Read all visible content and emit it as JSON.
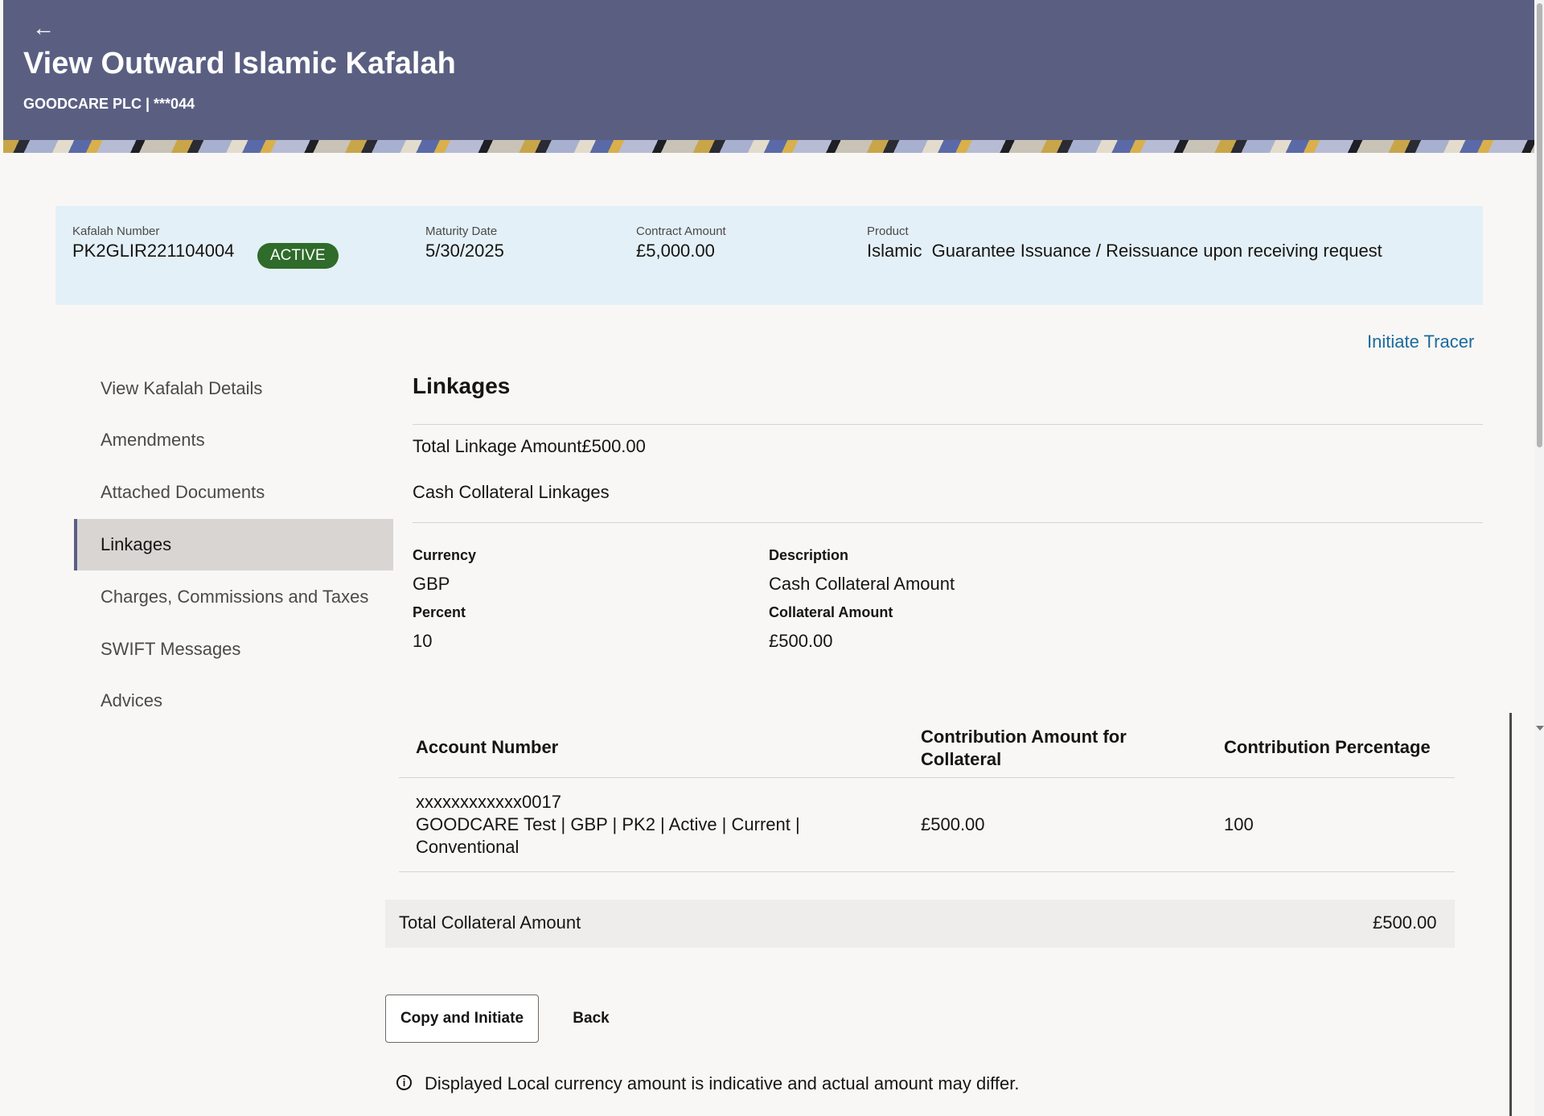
{
  "header": {
    "title": "View Outward Islamic Kafalah",
    "subtitle": "GOODCARE PLC | ***044"
  },
  "summary": {
    "kafalah_number_label": "Kafalah Number",
    "kafalah_number": "PK2GLIR221104004",
    "status": "ACTIVE",
    "status_color": "#2f6b2a",
    "maturity_date_label": "Maturity Date",
    "maturity_date": "5/30/2025",
    "contract_amount_label": "Contract Amount",
    "contract_amount": "£5,000.00",
    "product_label": "Product",
    "product": "Islamic  Guarantee Issuance / Reissuance upon receiving request"
  },
  "actions": {
    "initiate_tracer": "Initiate Tracer"
  },
  "nav": {
    "items": [
      {
        "label": "View Kafalah Details"
      },
      {
        "label": "Amendments"
      },
      {
        "label": "Attached Documents"
      },
      {
        "label": "Linkages"
      },
      {
        "label": "Charges, Commissions and Taxes"
      },
      {
        "label": "SWIFT Messages"
      },
      {
        "label": "Advices"
      }
    ],
    "active": "Linkages"
  },
  "linkages": {
    "title": "Linkages",
    "total_linkage": "Total Linkage Amount£500.00",
    "cash_collateral_heading": "Cash Collateral Linkages",
    "currency_label": "Currency",
    "currency": "GBP",
    "description_label": "Description",
    "description": "Cash Collateral Amount",
    "percent_label": "Percent",
    "percent": "10",
    "collateral_amount_label": "Collateral Amount",
    "collateral_amount": "£500.00"
  },
  "table": {
    "headers": {
      "account_number": "Account Number",
      "contribution_amount_line1": "Contribution Amount for",
      "contribution_amount_line2": "Collateral",
      "contribution_percentage": "Contribution Percentage"
    },
    "rows": [
      {
        "account_line1": "xxxxxxxxxxxx0017",
        "account_line2": "GOODCARE Test | GBP | PK2 | Active | Current |",
        "account_line3": "Conventional",
        "amount": "£500.00",
        "percentage": "100"
      }
    ]
  },
  "totals": {
    "label": "Total Collateral Amount",
    "value": "£500.00"
  },
  "buttons": {
    "copy_initiate": "Copy and Initiate",
    "back": "Back"
  },
  "footer": {
    "info_icon": "i",
    "note": "Displayed Local currency amount is indicative and actual amount may differ."
  },
  "colors": {
    "header_bg": "#5a5f82",
    "summary_bg": "#e4f0f7",
    "link": "#1a6b9c"
  }
}
